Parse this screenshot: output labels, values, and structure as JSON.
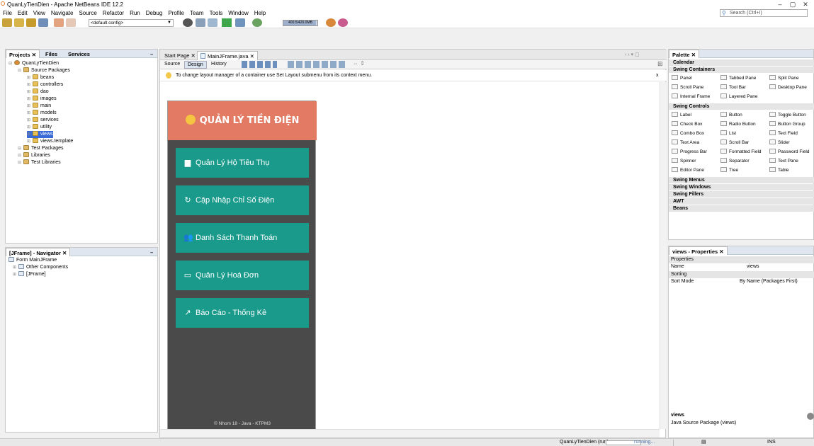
{
  "window": {
    "title": "QuanLyTienDien - Apache NetBeans IDE 12.2",
    "minimize": "–",
    "restore": "▢",
    "close": "✕"
  },
  "menu": [
    "File",
    "Edit",
    "View",
    "Navigate",
    "Source",
    "Refactor",
    "Run",
    "Debug",
    "Profile",
    "Team",
    "Tools",
    "Window",
    "Help"
  ],
  "search": {
    "placeholder": "Search (Ctrl+I)"
  },
  "toolbar": {
    "config": "<default config>",
    "memory": "400.5/420.0MB",
    "memory_fraction": 0.95
  },
  "projects_panel": {
    "tabs": [
      "Projects",
      "Files",
      "Services"
    ],
    "minimize": "–",
    "tree": [
      {
        "label": "QuanLyTienDien",
        "level": 0,
        "icon": "project"
      },
      {
        "label": "Source Packages",
        "level": 1,
        "icon": "folder"
      },
      {
        "label": "beans",
        "level": 2,
        "icon": "package"
      },
      {
        "label": "controllers",
        "level": 2,
        "icon": "package"
      },
      {
        "label": "dao",
        "level": 2,
        "icon": "package"
      },
      {
        "label": "images",
        "level": 2,
        "icon": "package"
      },
      {
        "label": "main",
        "level": 2,
        "icon": "package"
      },
      {
        "label": "models",
        "level": 2,
        "icon": "package"
      },
      {
        "label": "services",
        "level": 2,
        "icon": "package"
      },
      {
        "label": "utility",
        "level": 2,
        "icon": "package"
      },
      {
        "label": "views",
        "level": 2,
        "icon": "package",
        "selected": true
      },
      {
        "label": "views.template",
        "level": 2,
        "icon": "package"
      },
      {
        "label": "Test Packages",
        "level": 1,
        "icon": "folder"
      },
      {
        "label": "Libraries",
        "level": 1,
        "icon": "folder"
      },
      {
        "label": "Test Libraries",
        "level": 1,
        "icon": "folder"
      }
    ]
  },
  "navigator_panel": {
    "title": "[JFrame] - Navigator",
    "minimize": "–",
    "tree": [
      {
        "label": "Form MainJFrame",
        "level": 0
      },
      {
        "label": "Other Components",
        "level": 1
      },
      {
        "label": "[JFrame]",
        "level": 1
      }
    ]
  },
  "editor": {
    "tabs": [
      "Start Page",
      "MainJFrame.java"
    ],
    "modes": [
      "Source",
      "Design",
      "History"
    ],
    "active_mode": "Design",
    "hint": "To change layout manager of a container use Set Layout submenu from its context menu.",
    "hint_close": "x",
    "form": {
      "title": "QUẢN LÝ TIỀN ĐIỆN",
      "buttons": [
        {
          "label": "Quản Lý Hộ Tiêu Thụ",
          "icon": "book-icon",
          "glyph": "▆"
        },
        {
          "label": "Cập Nhập Chỉ Số Điện",
          "icon": "refresh-icon",
          "glyph": "↻"
        },
        {
          "label": "Danh Sách Thanh Toán",
          "icon": "users-icon",
          "glyph": "👥"
        },
        {
          "label": "Quản Lý Hoá Đơn",
          "icon": "credit-card-icon",
          "glyph": "▭"
        },
        {
          "label": "Báo Cáo - Thống Kê",
          "icon": "chart-icon",
          "glyph": "↗"
        }
      ],
      "footer": "© Nhom 18 - Java - KTPM3"
    }
  },
  "palette": {
    "title": "Palette",
    "categories": [
      {
        "name": "Calendar"
      },
      {
        "name": "Swing Containers",
        "items": [
          "Panel",
          "Tabbed Pane",
          "Split Pane",
          "Scroll Pane",
          "Tool Bar",
          "Desktop Pane",
          "Internal Frame",
          "Layered Pane"
        ]
      },
      {
        "name": "Swing Controls",
        "items": [
          "Label",
          "Button",
          "Toggle Button",
          "Check Box",
          "Radio Button",
          "Button Group",
          "Combo Box",
          "List",
          "Text Field",
          "Text Area",
          "Scroll Bar",
          "Slider",
          "Progress Bar",
          "Formatted Field",
          "Password Field",
          "Spinner",
          "Separator",
          "Text Pane",
          "Editor Pane",
          "Tree",
          "Table"
        ]
      },
      {
        "name": "Swing Menus"
      },
      {
        "name": "Swing Windows"
      },
      {
        "name": "Swing Fillers"
      },
      {
        "name": "AWT"
      },
      {
        "name": "Beans"
      }
    ]
  },
  "properties": {
    "title": "views - Properties",
    "sections": [
      {
        "name": "Properties",
        "rows": [
          {
            "key": "Name",
            "value": "views"
          }
        ]
      },
      {
        "name": "Sorting",
        "rows": [
          {
            "key": "Sort Mode",
            "value": "By Name (Packages First)"
          }
        ]
      }
    ],
    "footer_title": "views",
    "footer_desc": "Java Source Package (views)"
  },
  "status": {
    "run": "QuanLyTienDien (run)",
    "state": "running...",
    "mode": "INS"
  }
}
